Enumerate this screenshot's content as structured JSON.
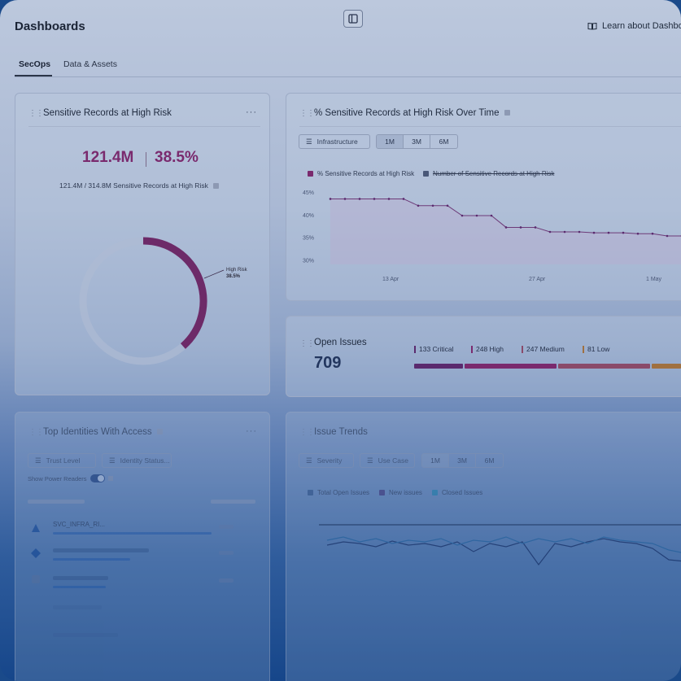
{
  "header": {
    "title": "Dashboards",
    "learn_link": "Learn about Dashbo"
  },
  "tabs": [
    {
      "label": "SecOps",
      "active": true
    },
    {
      "label": "Data & Assets",
      "active": false
    }
  ],
  "sensitive_card": {
    "title": "Sensitive Records at High Risk",
    "count": "121.4M",
    "percent": "38.5%",
    "subtitle": "121.4M / 314.8M Sensitive Records at High Risk",
    "donut_label": "High Risk",
    "donut_value": "38.5%",
    "donut_fraction": 0.385
  },
  "trend_card": {
    "title": "% Sensitive Records at High Risk Over Time",
    "filter": "Infrastructure",
    "ranges": [
      "1M",
      "3M",
      "6M"
    ],
    "selected_range": "1M",
    "legend": [
      {
        "label": "% Sensitive Records at High Risk",
        "color": "#7a2a6e"
      },
      {
        "label": "Number of Sensitive Records at High Risk",
        "color": "#4a5878"
      }
    ],
    "y_ticks": [
      "45%",
      "40%",
      "35%",
      "30%"
    ],
    "x_ticks": [
      "13 Apr",
      "27 Apr",
      "1 May"
    ]
  },
  "chart_data": {
    "type": "line",
    "title": "% Sensitive Records at High Risk Over Time",
    "xlabel": "",
    "ylabel": "",
    "x": [
      0,
      1,
      2,
      3,
      4,
      5,
      6,
      7,
      8,
      9,
      10,
      11,
      12,
      13,
      14,
      15,
      16,
      17,
      18,
      19,
      20,
      21,
      22,
      23,
      24
    ],
    "series": [
      {
        "name": "% Sensitive Records at High Risk",
        "values": [
          43.5,
          43.5,
          43.5,
          43.5,
          43.5,
          43.5,
          42,
          42,
          42,
          39.8,
          39.8,
          39.8,
          37.2,
          37.2,
          37.2,
          36.2,
          36.2,
          36.2,
          36,
          36,
          36,
          35.8,
          35.8,
          35.3,
          35.3
        ]
      }
    ],
    "ylim": [
      29,
      47
    ],
    "grid": false,
    "legend": "top-left"
  },
  "issues_card": {
    "title": "Open Issues",
    "count": "709",
    "severities": [
      {
        "label": "133 Critical",
        "count": 133,
        "color": "#5a2a6e"
      },
      {
        "label": "248 High",
        "count": 248,
        "color": "#7a2a6e"
      },
      {
        "label": "247 Medium",
        "count": 247,
        "color": "#8a4a6a"
      },
      {
        "label": "81 Low",
        "count": 81,
        "color": "#a07040"
      }
    ]
  },
  "identities_card": {
    "title": "Top Identities With Access",
    "filters": [
      "Trust Level",
      "Identity Status..."
    ],
    "toggle_label": "Show Power Readers",
    "first_identity": "SVC_INFRA_RI..."
  },
  "issue_trends_card": {
    "title": "Issue Trends",
    "filters": [
      "Severity",
      "Use Case"
    ],
    "ranges": [
      "1M",
      "3M",
      "6M"
    ],
    "selected_range": "1M",
    "legend": [
      {
        "label": "Total Open Issues",
        "color": "#3a5a8a"
      },
      {
        "label": "New issues",
        "color": "#4a3a7a"
      },
      {
        "label": "Closed Issues",
        "color": "#2a8ab0"
      }
    ]
  }
}
